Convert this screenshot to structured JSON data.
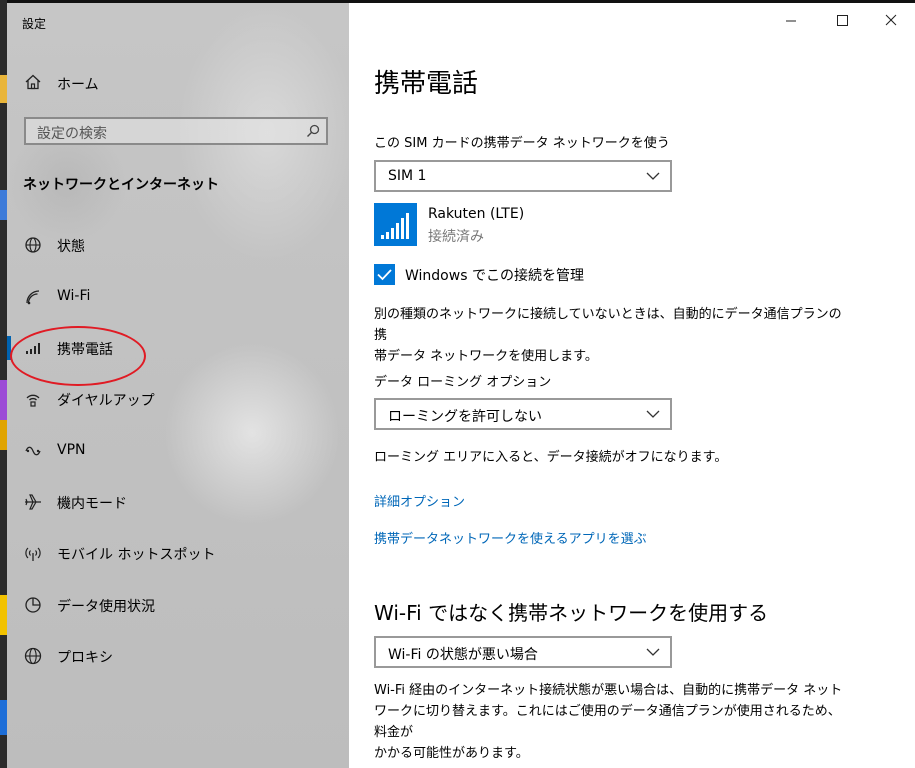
{
  "app": {
    "title": "設定"
  },
  "sidebar": {
    "home": "ホーム",
    "search_placeholder": "設定の検索",
    "section_title": "ネットワークとインターネット",
    "items": [
      {
        "label": "状態",
        "icon": "globe-status-icon"
      },
      {
        "label": "Wi-Fi",
        "icon": "wifi-icon"
      },
      {
        "label": "携帯電話",
        "icon": "cellular-signal-icon",
        "active": true
      },
      {
        "label": "ダイヤルアップ",
        "icon": "dialup-icon"
      },
      {
        "label": "VPN",
        "icon": "vpn-icon"
      },
      {
        "label": "機内モード",
        "icon": "airplane-icon"
      },
      {
        "label": "モバイル ホットスポット",
        "icon": "hotspot-icon"
      },
      {
        "label": "データ使用状況",
        "icon": "data-usage-icon"
      },
      {
        "label": "プロキシ",
        "icon": "proxy-globe-icon"
      }
    ]
  },
  "window_controls": [
    "minimize",
    "maximize",
    "close"
  ],
  "main": {
    "title": "携帯電話",
    "sim_label": "この SIM カードの携帯データ ネットワークを使う",
    "sim_value": "SIM 1",
    "network": {
      "name": "Rakuten (LTE)",
      "status": "接続済み"
    },
    "manage_checkbox": {
      "label": "Windows でこの接続を管理",
      "checked": true
    },
    "auto_desc_line1": "別の種類のネットワークに接続していないときは、自動的にデータ通信プランの携",
    "auto_desc_line2": "帯データ ネットワークを使用します。",
    "roaming_label": "データ ローミング オプション",
    "roaming_value": "ローミングを許可しない",
    "roaming_desc": "ローミング エリアに入ると、データ接続がオフになります。",
    "advanced_link": "詳細オプション",
    "apps_link": "携帯データネットワークを使えるアプリを選ぶ",
    "wifi_heading": "Wi-Fi ではなく携帯ネットワークを使用する",
    "wifi_value": "Wi-Fi の状態が悪い場合",
    "wifi_desc_line1": "Wi-Fi 経由のインターネット接続状態が悪い場合は、自動的に携帯データ ネット",
    "wifi_desc_line2": "ワークに切り替えます。これにはご使用のデータ通信プランが使用されるため、料金が",
    "wifi_desc_line3": "かかる可能性があります。"
  },
  "colors": {
    "accent": "#0078d7",
    "link": "#0067b8",
    "annotation": "#e01b24"
  }
}
